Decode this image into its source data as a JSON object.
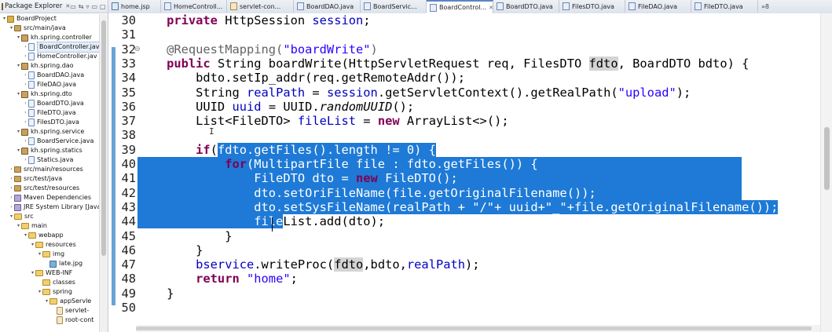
{
  "explorer": {
    "title": "Package Explorer",
    "close": "✕",
    "tools": [
      "▭",
      "⇆",
      "▿",
      "▭",
      "▢"
    ],
    "tree": [
      {
        "label": "BoardProject",
        "depth": 0,
        "icon": "project",
        "tw": "▾"
      },
      {
        "label": "src/main/java",
        "depth": 1,
        "icon": "srcfolder",
        "tw": "▾"
      },
      {
        "label": "kh.spring.controller",
        "depth": 2,
        "icon": "pkg",
        "tw": "▾"
      },
      {
        "label": "BoardController.jav",
        "depth": 3,
        "icon": "java",
        "tw": "›",
        "selected": true
      },
      {
        "label": "HomeController.jav",
        "depth": 3,
        "icon": "java",
        "tw": "›"
      },
      {
        "label": "kh.spring.dao",
        "depth": 2,
        "icon": "pkg",
        "tw": "▾"
      },
      {
        "label": "BoardDAO.java",
        "depth": 3,
        "icon": "java",
        "tw": "›"
      },
      {
        "label": "FileDAO.java",
        "depth": 3,
        "icon": "java",
        "tw": "›"
      },
      {
        "label": "kh.spring.dto",
        "depth": 2,
        "icon": "pkg",
        "tw": "▾"
      },
      {
        "label": "BoardDTO.java",
        "depth": 3,
        "icon": "java",
        "tw": "›"
      },
      {
        "label": "FileDTO.java",
        "depth": 3,
        "icon": "java",
        "tw": "›"
      },
      {
        "label": "FilesDTO.java",
        "depth": 3,
        "icon": "java",
        "tw": "›"
      },
      {
        "label": "kh.spring.service",
        "depth": 2,
        "icon": "pkg",
        "tw": "▾"
      },
      {
        "label": "BoardService.java",
        "depth": 3,
        "icon": "java",
        "tw": "›"
      },
      {
        "label": "kh.spring.statics",
        "depth": 2,
        "icon": "pkg",
        "tw": "▾"
      },
      {
        "label": "Statics.java",
        "depth": 3,
        "icon": "java",
        "tw": "›"
      },
      {
        "label": "src/main/resources",
        "depth": 1,
        "icon": "srcfolder",
        "tw": "›"
      },
      {
        "label": "src/test/java",
        "depth": 1,
        "icon": "srcfolder",
        "tw": "›"
      },
      {
        "label": "src/test/resources",
        "depth": 1,
        "icon": "srcfolder",
        "tw": "›"
      },
      {
        "label": "Maven Dependencies",
        "depth": 1,
        "icon": "lib",
        "tw": "›"
      },
      {
        "label": "JRE System Library [JavaS",
        "depth": 1,
        "icon": "lib",
        "tw": "›"
      },
      {
        "label": "src",
        "depth": 1,
        "icon": "folder",
        "tw": "▾"
      },
      {
        "label": "main",
        "depth": 2,
        "icon": "folder",
        "tw": "▾"
      },
      {
        "label": "webapp",
        "depth": 3,
        "icon": "folder",
        "tw": "▾"
      },
      {
        "label": "resources",
        "depth": 4,
        "icon": "folder",
        "tw": "▾"
      },
      {
        "label": "img",
        "depth": 5,
        "icon": "folder",
        "tw": "▾"
      },
      {
        "label": "late.jpg",
        "depth": 6,
        "icon": "img",
        "tw": ""
      },
      {
        "label": "WEB-INF",
        "depth": 4,
        "icon": "folder",
        "tw": "▾"
      },
      {
        "label": "classes",
        "depth": 5,
        "icon": "folder",
        "tw": ""
      },
      {
        "label": "spring",
        "depth": 5,
        "icon": "folder",
        "tw": "▾"
      },
      {
        "label": "appServle",
        "depth": 6,
        "icon": "folder",
        "tw": "▾"
      },
      {
        "label": "servlet-",
        "depth": 7,
        "icon": "xml",
        "tw": ""
      },
      {
        "label": "root-cont",
        "depth": 7,
        "icon": "xml",
        "tw": ""
      }
    ]
  },
  "tabs": [
    {
      "label": "home.jsp",
      "icon": "jsp"
    },
    {
      "label": "HomeControll...",
      "icon": "java"
    },
    {
      "label": "servlet-con...",
      "icon": "xml"
    },
    {
      "label": "BoardDAO.java",
      "icon": "java"
    },
    {
      "label": "BoardServic...",
      "icon": "java"
    },
    {
      "label": "BoardControl...",
      "icon": "java",
      "active": true,
      "close": "✕"
    },
    {
      "label": "BoardDTO.java",
      "icon": "java"
    },
    {
      "label": "FilesDTO.java",
      "icon": "java"
    },
    {
      "label": "FileDAO.java",
      "icon": "java"
    },
    {
      "label": "FileDTO.java",
      "icon": "java"
    },
    {
      "label": "»8",
      "icon": "",
      "overflow": true
    }
  ],
  "editor": {
    "line_numbers": [
      "30",
      "31",
      "32",
      "33",
      "34",
      "35",
      "36",
      "37",
      "38",
      "39",
      "40",
      "41",
      "42",
      "43",
      "44",
      "45",
      "46",
      "47",
      "48",
      "49",
      "50"
    ],
    "fold_marker_line": "32",
    "fold_marker": "⊖",
    "ibeam": "I",
    "lines": [
      [
        [
          "kw",
          "    private "
        ],
        [
          "",
          "HttpSession "
        ],
        [
          "fld",
          "session"
        ],
        [
          "",
          ";"
        ]
      ],
      [
        [
          "",
          ""
        ]
      ],
      [
        [
          "ann",
          "    @RequestMapping("
        ],
        [
          "str",
          "\"boardWrite\""
        ],
        [
          "ann",
          ")"
        ]
      ],
      [
        [
          "kw",
          "    public "
        ],
        [
          "",
          "String boardWrite(HttpServletRequest req, FilesDTO "
        ],
        [
          "occ",
          "fdto"
        ],
        [
          "",
          ", BoardDTO bdto) {"
        ]
      ],
      [
        [
          "",
          "        bdto.setIp_addr(req.getRemoteAddr());"
        ]
      ],
      [
        [
          "",
          "        String "
        ],
        [
          "fld",
          "realPath"
        ],
        [
          "",
          " = "
        ],
        [
          "fld",
          "session"
        ],
        [
          "",
          ".getServletContext().getRealPath("
        ],
        [
          "str",
          "\"upload\""
        ],
        [
          "",
          ");"
        ]
      ],
      [
        [
          "",
          "        UUID "
        ],
        [
          "fld",
          "uuid"
        ],
        [
          "",
          " = UUID."
        ],
        [
          "ital",
          "randomUUID"
        ],
        [
          "",
          "();"
        ]
      ],
      [
        [
          "",
          "        List<FileDTO> "
        ],
        [
          "fld",
          "fileList"
        ],
        [
          "",
          " = "
        ],
        [
          "kw",
          "new "
        ],
        [
          "",
          "ArrayList<>();"
        ]
      ],
      [
        [
          "",
          ""
        ]
      ],
      [
        [
          "kw",
          "        if"
        ],
        [
          "",
          "("
        ],
        [
          "sel",
          "fdto.getFiles().length != 0) {"
        ]
      ],
      [
        [
          "sel",
          "            "
        ],
        [
          "sel kw",
          "for"
        ],
        [
          "sel",
          "(MultipartFile file : fdto.getFiles()) {"
        ]
      ],
      [
        [
          "sel",
          "                FileDTO dto = "
        ],
        [
          "sel kw",
          "new "
        ],
        [
          "sel",
          "FileDTO();"
        ]
      ],
      [
        [
          "sel",
          "                dto.setOriFileName(file.getOriginalFilename());"
        ]
      ],
      [
        [
          "sel",
          "                dto.setSysFileName(realPath + \"/\"+ uuid+\"_\"+file.getOriginalFilename());"
        ]
      ],
      [
        [
          "sel",
          "                file"
        ],
        [
          "",
          "List.add(dto);"
        ]
      ],
      [
        [
          "",
          "            }"
        ]
      ],
      [
        [
          "",
          "        }"
        ]
      ],
      [
        [
          "fld",
          "        bservice"
        ],
        [
          "",
          ".writeProc("
        ],
        [
          "occ",
          "fdto"
        ],
        [
          "",
          ",bdto,"
        ],
        [
          "fld",
          "realPath"
        ],
        [
          "",
          ");"
        ]
      ],
      [
        [
          "kw",
          "        return "
        ],
        [
          "str",
          "\"home\""
        ],
        [
          "",
          ";"
        ]
      ],
      [
        [
          "",
          "    }"
        ]
      ],
      [
        [
          "",
          ""
        ]
      ]
    ]
  }
}
